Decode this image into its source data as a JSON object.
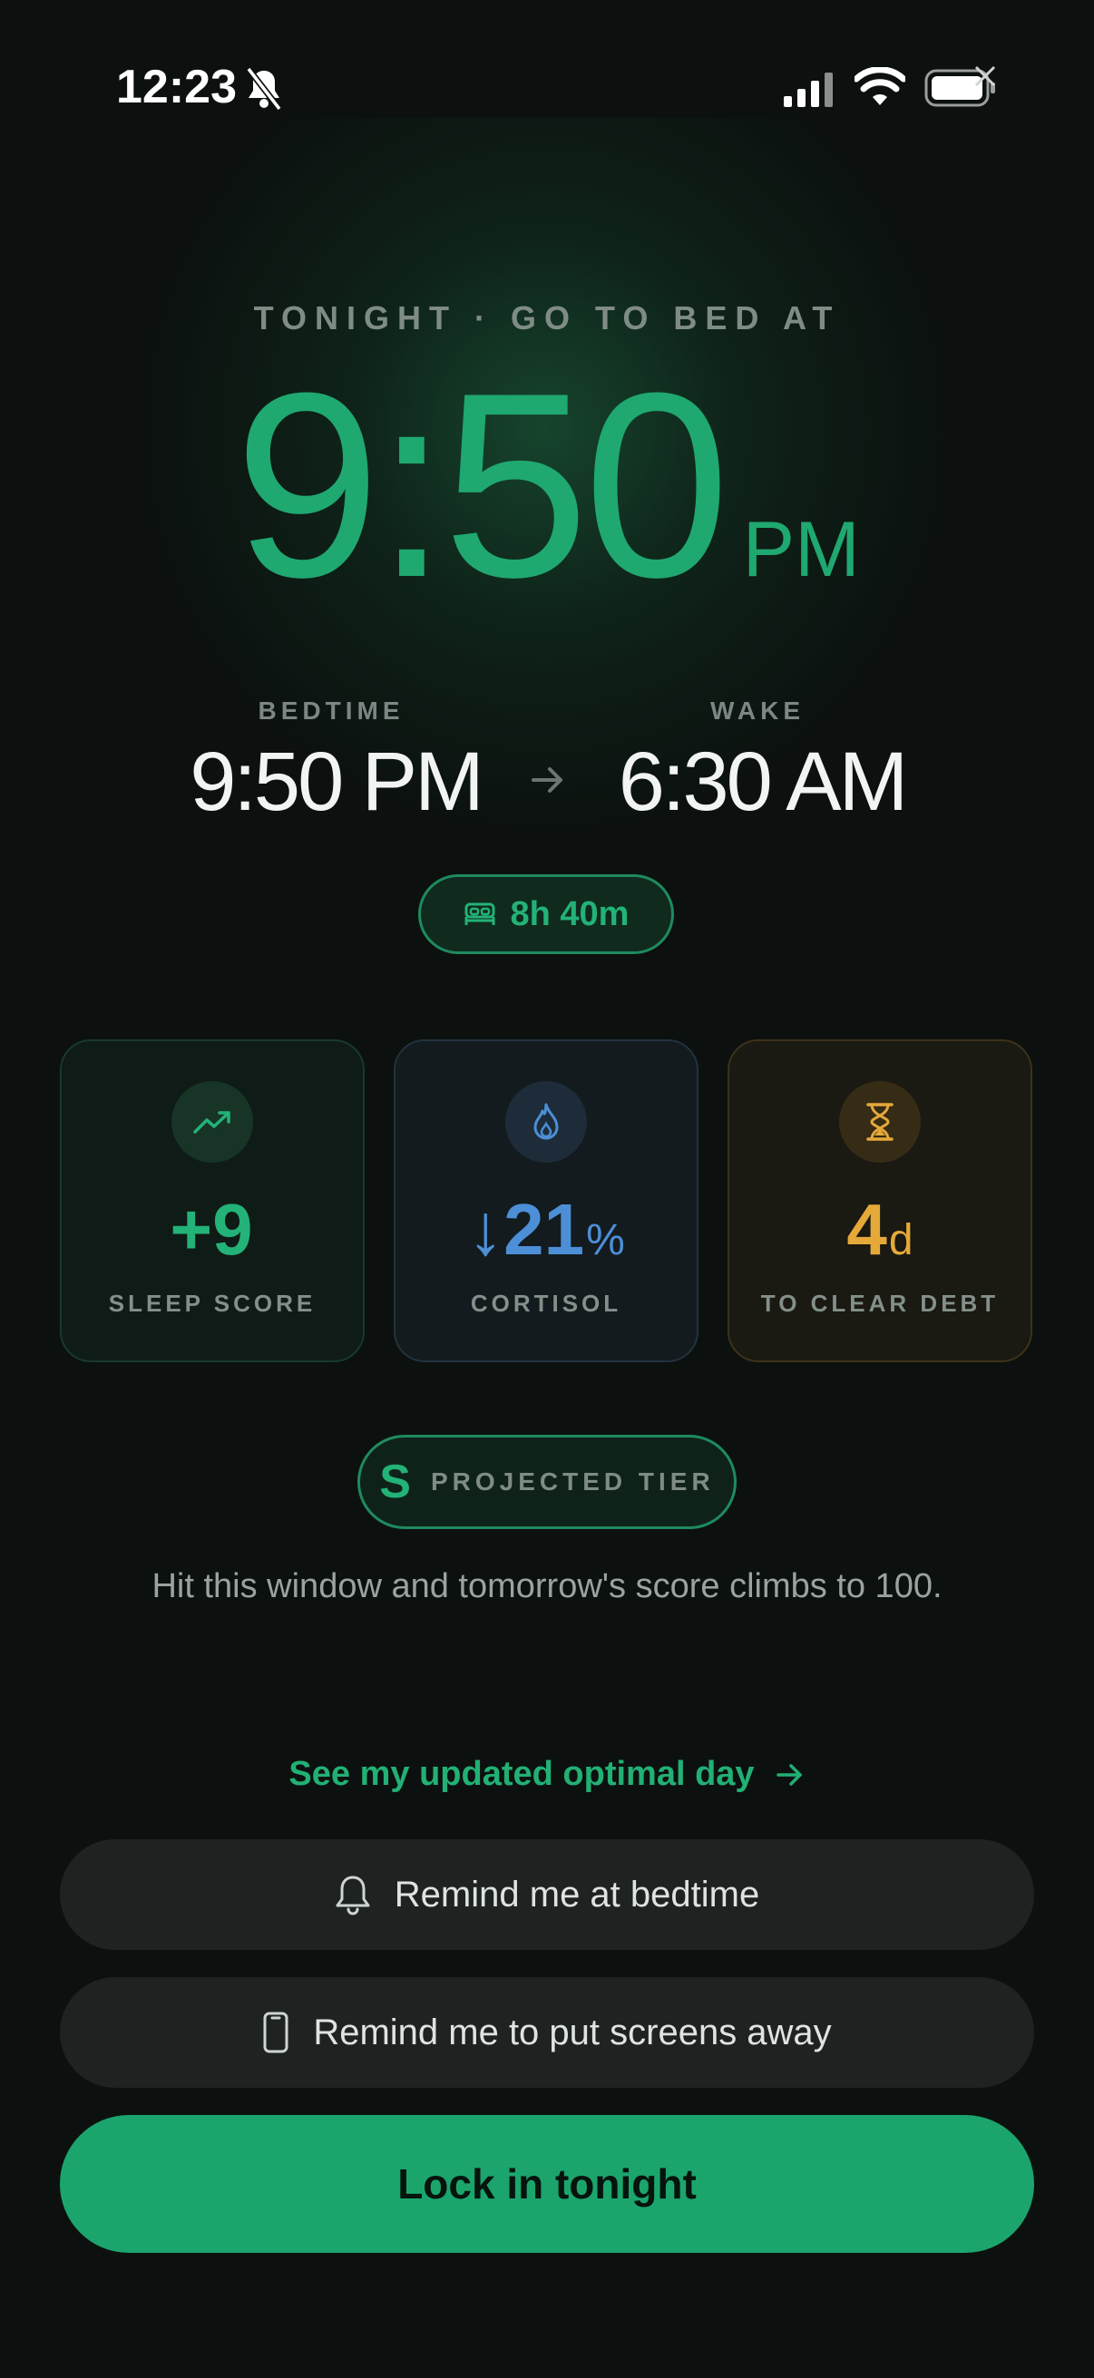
{
  "status_bar": {
    "time": "12:23"
  },
  "header": {
    "kicker": "TONIGHT · GO TO BED AT",
    "big_time": "9:50",
    "big_ampm": "PM"
  },
  "schedule": {
    "bedtime_label": "BEDTIME",
    "bedtime_value": "9:50 PM",
    "wake_label": "WAKE",
    "wake_value": "6:30 AM",
    "duration": "8h 40m"
  },
  "stats": [
    {
      "value": "+9",
      "unit": "",
      "caption": "SLEEP SCORE",
      "icon": "trending-up-icon",
      "color": "#23b277"
    },
    {
      "value": "↓21",
      "unit": "%",
      "caption": "CORTISOL",
      "icon": "flame-icon",
      "color": "#4c8fd6"
    },
    {
      "value": "4",
      "unit": "d",
      "caption": "TO CLEAR DEBT",
      "icon": "hourglass-icon",
      "color": "#e5a93a"
    }
  ],
  "tier": {
    "letter": "S",
    "label": "PROJECTED TIER"
  },
  "hint": "Hit this window and tomorrow's score climbs to 100.",
  "actions": {
    "link_label": "See my updated optimal day",
    "remind_bedtime": "Remind me at bedtime",
    "remind_screens": "Remind me to put screens away",
    "primary": "Lock in tonight"
  },
  "colors": {
    "accent": "#1ba56c",
    "background": "#0c110f"
  }
}
